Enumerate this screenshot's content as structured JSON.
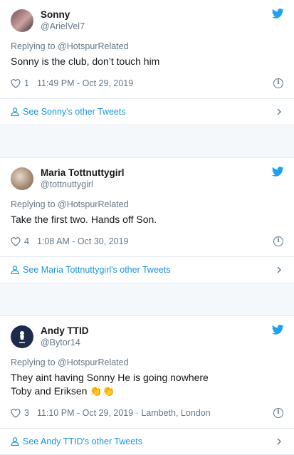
{
  "colors": {
    "link": "#1b95e0",
    "muted": "#657786",
    "twitter_blue": "#1da1f2"
  },
  "tweets": [
    {
      "display_name": "Sonny",
      "handle": "@ArielVel7",
      "replying": "Replying to @HotspurRelated",
      "text_lines": [
        "Sonny is the club, don’t touch him"
      ],
      "likes": "1",
      "timestamp": "11:49 PM - Oct 29, 2019",
      "footer_link": "See Sonny's other Tweets",
      "avatar": "photo-avatar"
    },
    {
      "display_name": "Maria Tottnuttygirl",
      "handle": "@tottnuttygirl",
      "replying": "Replying to @HotspurRelated",
      "text_lines": [
        "Take the first two. Hands off Son."
      ],
      "likes": "4",
      "timestamp": "1:08 AM - Oct 30, 2019",
      "footer_link": "See Maria Tottnuttygirl's other Tweets",
      "avatar": "photo-avatar"
    },
    {
      "display_name": "Andy TTID",
      "handle": "@Bytor14",
      "replying": "Replying to @HotspurRelated",
      "text_lines": [
        "They aint having Sonny He is going nowhere",
        "Toby and Eriksen 👏👏"
      ],
      "likes": "3",
      "timestamp": "11:10 PM - Oct 29, 2019 · Lambeth, London",
      "footer_link": "See Andy TTID's other Tweets",
      "avatar": "spurs-logo-avatar"
    }
  ]
}
